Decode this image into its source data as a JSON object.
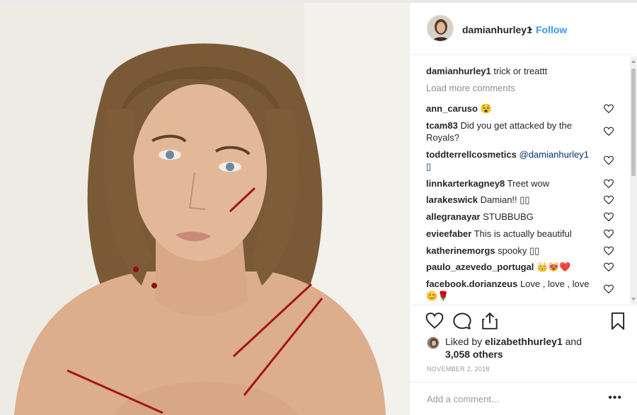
{
  "post": {
    "username": "damianhurley1",
    "separator": "•",
    "follow_label": "Follow",
    "caption_user": "damianhurley1",
    "caption_text": "trick or treattt",
    "load_more": "Load more comments",
    "comments": [
      {
        "user": "ann_caruso",
        "text": "😵"
      },
      {
        "user": "tcam83",
        "text": "Did you get attacked by the Royals?"
      },
      {
        "user": "toddterrellcosmetics",
        "text": "@damianhurley1 ▯"
      },
      {
        "user": "linnkarterkagney8",
        "text": "Treet wow"
      },
      {
        "user": "larakeswick",
        "text": "Damian!! ▯▯"
      },
      {
        "user": "allegranayar",
        "text": "STUBBUBG"
      },
      {
        "user": "evieefaber",
        "text": "This is actually beautiful"
      },
      {
        "user": "katherinemorgs",
        "text": "spooky ▯▯"
      },
      {
        "user": "paulo_azevedo_portugal",
        "text": "👑😻❤️"
      },
      {
        "user": "facebook.dorianzeus",
        "text": "Love , love , love 😊🌹"
      }
    ],
    "likes": {
      "prefix": "Liked by",
      "user": "elizabethhurley1",
      "and": "and",
      "others": "3,058 others"
    },
    "date": "NOVEMBER 2, 2018",
    "add_comment_placeholder": "Add a comment...",
    "more_label": "•••"
  },
  "icons": {
    "avatar": "profile-avatar",
    "like": "heart-icon",
    "comment": "comment-bubble-icon",
    "share": "share-icon",
    "save": "bookmark-icon",
    "comment_like": "small-heart-icon"
  },
  "colors": {
    "accent": "#3897f0",
    "text": "#262626",
    "muted": "#8e8e8e",
    "border": "#efefef"
  }
}
